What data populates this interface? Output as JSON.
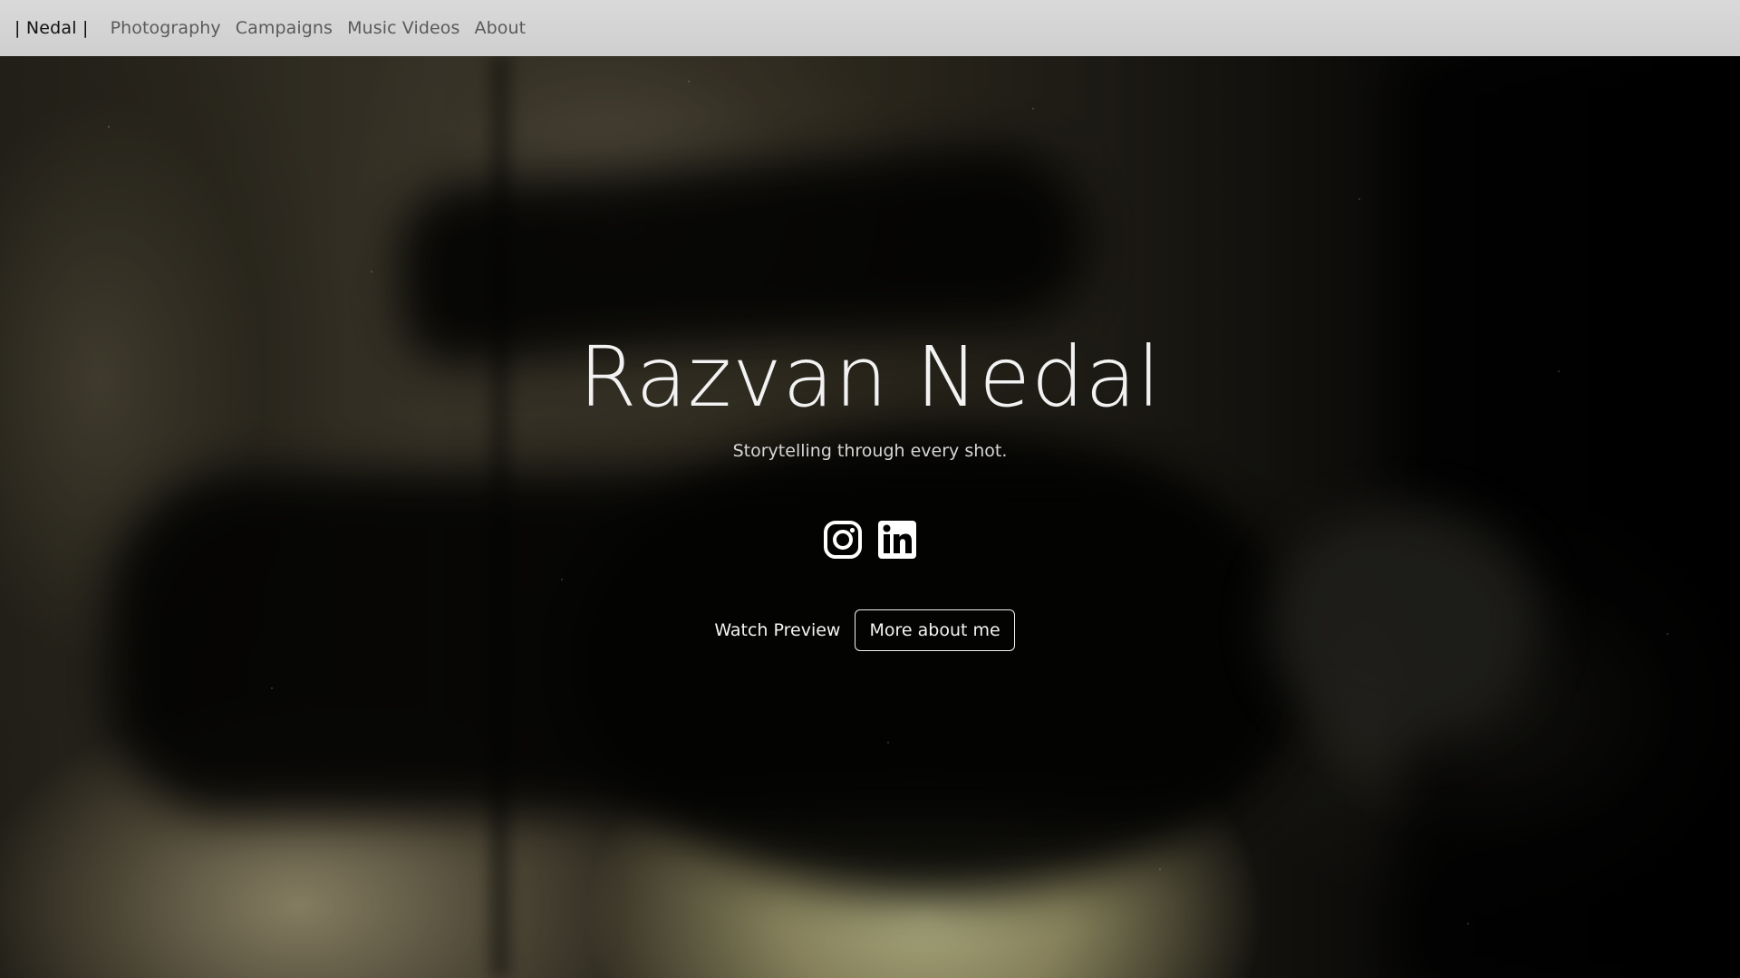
{
  "navbar": {
    "brand": "| Nedal |",
    "links": [
      {
        "label": "Photography"
      },
      {
        "label": "Campaigns"
      },
      {
        "label": "Music Videos"
      },
      {
        "label": "About"
      }
    ]
  },
  "hero": {
    "title": "Razvan Nedal",
    "subtitle": "Storytelling through every shot.",
    "social": [
      {
        "icon": "instagram-icon"
      },
      {
        "icon": "linkedin-icon"
      }
    ],
    "buttons": {
      "watch_preview": "Watch Preview",
      "more_about": "More about me"
    }
  },
  "colors": {
    "navbar_bg": "#d3d3d3",
    "brand_text": "#111111",
    "nav_link_text": "#5a5a5a",
    "hero_text": "#f2f2f2"
  }
}
